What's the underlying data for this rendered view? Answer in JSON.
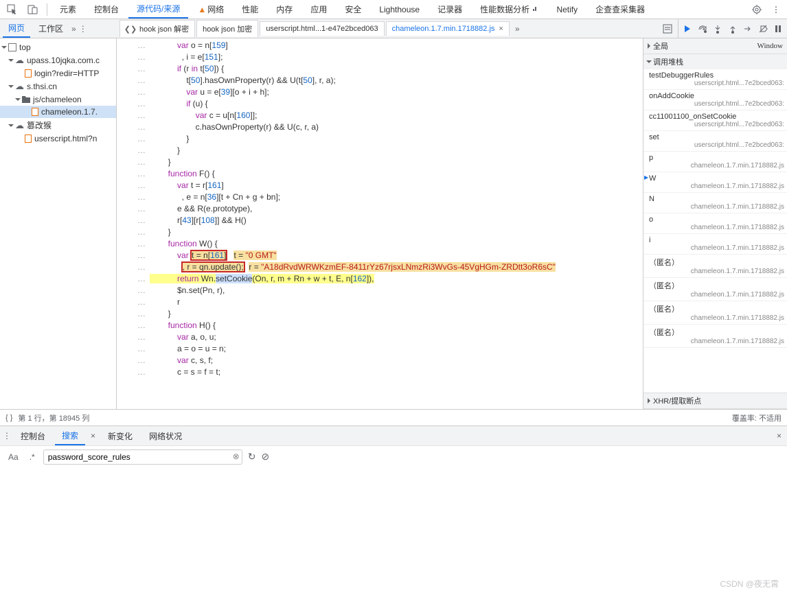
{
  "topTabs": {
    "elements": "元素",
    "console": "控制台",
    "sources": "源代码/来源",
    "network": "网络",
    "performance": "性能",
    "memory": "内存",
    "application": "应用",
    "security": "安全",
    "lighthouse": "Lighthouse",
    "recorder": "记录器",
    "perfInsight": "性能数据分析",
    "netify": "Netify",
    "qcc": "企查查采集器"
  },
  "subTabs": {
    "page": "网页",
    "workspace": "工作区"
  },
  "fileTabs": {
    "t1": "hook json 解密",
    "t2": "hook json 加密",
    "t3": "userscript.html...1-e47e2bced063",
    "t4": "chameleon.1.7.min.1718882.js"
  },
  "tree": {
    "top": "top",
    "d1": "upass.10jqka.com.c",
    "d1a": "login?redir=HTTP",
    "d2": "s.thsi.cn",
    "d2a": "js/chameleon",
    "d2a1": "chameleon.1.7.",
    "d3": "篡改猴",
    "d3a": "userscript.html?n"
  },
  "right": {
    "global": "全局",
    "window": "Window",
    "callstack": "调用堆栈",
    "stack": [
      {
        "fn": "testDebuggerRules",
        "loc": "userscript.html...7e2bced063:"
      },
      {
        "fn": "onAddCookie",
        "loc": "userscript.html...7e2bced063:"
      },
      {
        "fn": "cc11001100_onSetCookie",
        "loc": "userscript.html...7e2bced063:"
      },
      {
        "fn": "set",
        "loc": "userscript.html...7e2bced063:"
      },
      {
        "fn": "p",
        "loc": "chameleon.1.7.min.1718882.js"
      },
      {
        "fn": "W",
        "loc": "chameleon.1.7.min.1718882.js",
        "cur": true
      },
      {
        "fn": "N",
        "loc": "chameleon.1.7.min.1718882.js"
      },
      {
        "fn": "o",
        "loc": "chameleon.1.7.min.1718882.js"
      },
      {
        "fn": "i",
        "loc": "chameleon.1.7.min.1718882.js"
      },
      {
        "fn": "（匿名）",
        "loc": "chameleon.1.7.min.1718882.js"
      },
      {
        "fn": "（匿名）",
        "loc": "chameleon.1.7.min.1718882.js"
      },
      {
        "fn": "（匿名）",
        "loc": "chameleon.1.7.min.1718882.js"
      },
      {
        "fn": "（匿名）",
        "loc": "chameleon.1.7.min.1718882.js"
      }
    ],
    "xhr": "XHR/提取断点"
  },
  "status": {
    "pos": "第 1 行，第 18945 列",
    "coverage": "覆盖率: 不适用"
  },
  "drawer": {
    "console": "控制台",
    "search": "搜索",
    "changes": "新变化",
    "netlog": "网络状况"
  },
  "search": {
    "value": "password_score_rules"
  },
  "watermark": "CSDN @夜无霄",
  "dash": "…"
}
